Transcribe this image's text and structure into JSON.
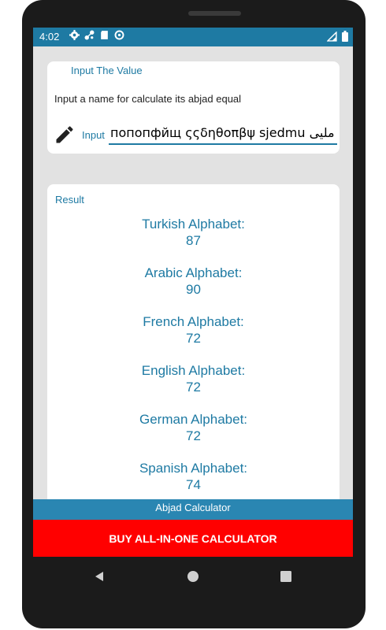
{
  "status_bar": {
    "time": "4:02",
    "left_icons": [
      "gear-icon",
      "network-icon",
      "sd-card-icon",
      "data-saver-icon"
    ],
    "right_icons": [
      "signal-icon",
      "battery-icon"
    ]
  },
  "input_card": {
    "title": "Input The Value",
    "hint": "Input a name for calculate its abjad equal",
    "label": "Input",
    "value": "попопфйщ ςςδηθοπβψ sjedmu ملیی"
  },
  "result_card": {
    "title": "Result",
    "results": [
      {
        "name": "Turkish Alphabet:",
        "value": "87"
      },
      {
        "name": "Arabic Alphabet:",
        "value": "90"
      },
      {
        "name": "French Alphabet:",
        "value": "72"
      },
      {
        "name": "English Alphabet:",
        "value": "72"
      },
      {
        "name": "German Alphabet:",
        "value": "72"
      },
      {
        "name": "Spanish Alphabet:",
        "value": "74"
      }
    ]
  },
  "footer": {
    "app_name": "Abjad Calculator",
    "buy_label": "BUY ALL-IN-ONE CALCULATOR"
  },
  "colors": {
    "accent": "#1e7aa3",
    "buy_button": "#ff0000",
    "background": "#e2e2e2"
  }
}
